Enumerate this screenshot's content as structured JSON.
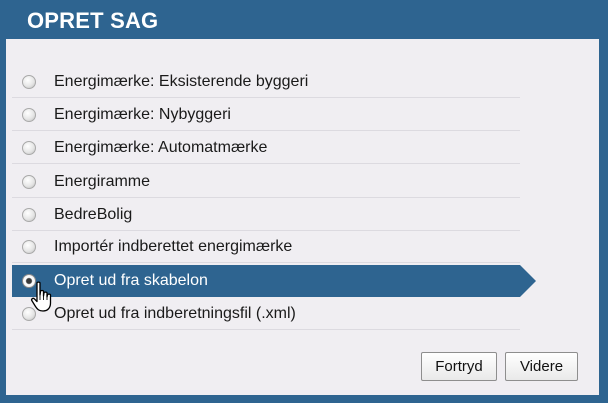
{
  "dialog": {
    "title": "OPRET SAG",
    "options": [
      {
        "label": "Energimærke: Eksisterende byggeri",
        "selected": false
      },
      {
        "label": "Energimærke: Nybyggeri",
        "selected": false
      },
      {
        "label": "Energimærke: Automatmærke",
        "selected": false
      },
      {
        "label": "Energiramme",
        "selected": false
      },
      {
        "label": "BedreBolig",
        "selected": false
      },
      {
        "label": "Importér indberettet energimærke",
        "selected": false
      },
      {
        "label": "Opret ud fra skabelon",
        "selected": true
      },
      {
        "label": "Opret ud fra indberetningsfil (.xml)",
        "selected": false
      }
    ],
    "buttons": {
      "cancel": "Fortryd",
      "next": "Videre"
    },
    "colors": {
      "header": "#2e6490",
      "panel": "#f0eef2",
      "selected_row": "#2e6490"
    },
    "cursor_icon": "hand-pointer-icon"
  }
}
